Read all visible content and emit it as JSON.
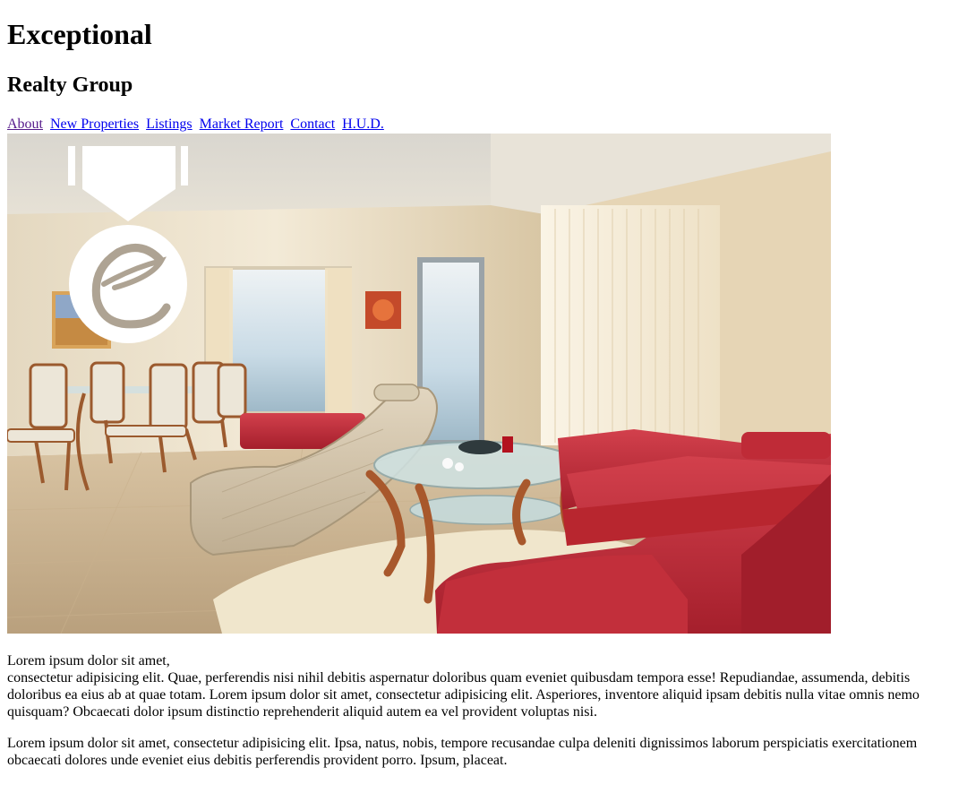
{
  "header": {
    "title": "Exceptional",
    "subtitle": "Realty Group"
  },
  "nav": {
    "items": [
      {
        "label": "About",
        "visited": true
      },
      {
        "label": "New Properties",
        "visited": false
      },
      {
        "label": "Listings",
        "visited": false
      },
      {
        "label": "Market Report",
        "visited": false
      },
      {
        "label": "Contact",
        "visited": false
      },
      {
        "label": "H.U.D.",
        "visited": false
      }
    ]
  },
  "hero": {
    "logo_icon": "medal-e-logo-icon",
    "photo": "living-room-photo"
  },
  "content": {
    "intro_line": "Lorem ipsum dolor sit amet,",
    "paragraph_1_rest": "consectetur adipisicing elit. Quae, perferendis nisi nihil debitis aspernatur doloribus quam eveniet quibusdam tempora esse! Repudiandae, assumenda, debitis doloribus ea eius ab at quae totam. Lorem ipsum dolor sit amet, consectetur adipisicing elit. Asperiores, inventore aliquid ipsam debitis nulla vitae omnis nemo quisquam? Obcaecati dolor ipsum distinctio reprehenderit aliquid autem ea vel provident voluptas nisi.",
    "paragraph_2": "Lorem ipsum dolor sit amet, consectetur adipisicing elit. Ipsa, natus, nobis, tempore recusandae culpa deleniti dignissimos laborum perspiciatis exercitationem obcaecati dolores unde eveniet eius debitis perferendis provident porro. Ipsum, placeat."
  },
  "colors": {
    "link": "#0000ee",
    "link_visited": "#551a8b",
    "sofa_red": "#c8323e",
    "wall_cream": "#efe3cc"
  }
}
